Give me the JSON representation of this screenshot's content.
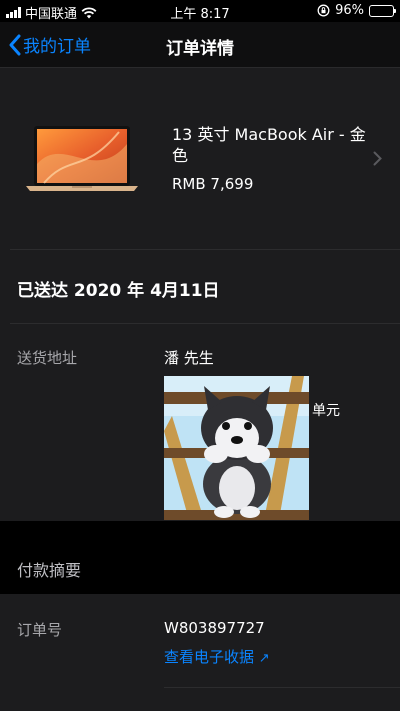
{
  "status": {
    "carrier": "中国联通",
    "time": "上午 8:17",
    "battery": "96%",
    "battery_level": 0.96
  },
  "nav": {
    "back_label": "我的订单",
    "title": "订单详情"
  },
  "product": {
    "name": "13 英寸 MacBook Air - 金色",
    "price": "RMB 7,699"
  },
  "delivery": {
    "status": "已送达 2020 年 4月11日"
  },
  "address": {
    "label": "送货地址",
    "name": "潘 先生",
    "unit_fragment": "单元"
  },
  "payment": {
    "section_title": "付款摘要"
  },
  "order": {
    "label": "订单号",
    "number": "W803897727",
    "receipt_link": "查看电子收据",
    "receipt_arrow": "↗"
  },
  "colors": {
    "background": "#1c1c1e",
    "accent": "#0a84ff",
    "section_black": "#000000"
  },
  "icons": [
    "signal-icon",
    "wifi-icon",
    "orientation-lock-icon",
    "battery-icon",
    "back-chevron-icon",
    "chevron-right-icon",
    "macbook-image",
    "puppy-image"
  ]
}
